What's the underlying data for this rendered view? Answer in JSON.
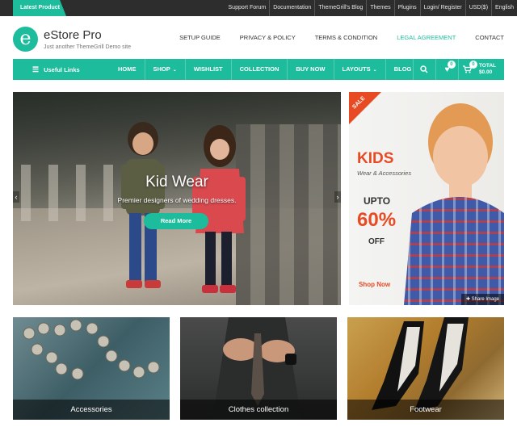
{
  "topbar": {
    "latest_label": "Latest Product",
    "links": [
      "Support Forum",
      "Documentation",
      "ThemeGrill's Blog",
      "Themes",
      "Plugins",
      "Login/ Register",
      "USD($)",
      "English"
    ]
  },
  "header": {
    "logo_letter": "e",
    "site_title": "eStore Pro",
    "tagline": "Just another ThemeGrill Demo site",
    "menu": [
      "SETUP GUIDE",
      "PRIVACY & POLICY",
      "TERMS & CONDITION",
      "LEGAL AGREEMENT",
      "CONTACT"
    ]
  },
  "navbar": {
    "useful_links": "Useful Links",
    "items": [
      {
        "label": "HOME",
        "caret": ""
      },
      {
        "label": "SHOP",
        "caret": "⌄"
      },
      {
        "label": "WISHLIST",
        "caret": ""
      },
      {
        "label": "COLLECTION",
        "caret": ""
      },
      {
        "label": "BUY NOW",
        "caret": ""
      },
      {
        "label": "LAYOUTS",
        "caret": "⌄"
      },
      {
        "label": "BLOG",
        "caret": ""
      }
    ],
    "wishlist_count": "0",
    "cart_count": "0",
    "total_label": "TOTAL",
    "total_value": "$0.00"
  },
  "hero": {
    "title": "Kid Wear",
    "subtitle": "Premier designers of wedding dresses.",
    "button": "Read More",
    "prev": "‹",
    "next": "›"
  },
  "promo": {
    "sale": "SALE",
    "kids": "KIDS",
    "wear": "Wear & Accessories",
    "upto": "UPTO",
    "percent": "60%",
    "off": "OFF",
    "shop_now": "Shop Now",
    "share": "Share Image"
  },
  "categories": [
    {
      "label": "Accessories"
    },
    {
      "label": "Clothes collection"
    },
    {
      "label": "Footwear"
    }
  ],
  "colors": {
    "accent": "#1cbc9c",
    "sale": "#e84a23",
    "topbar": "#2d2d2d"
  }
}
